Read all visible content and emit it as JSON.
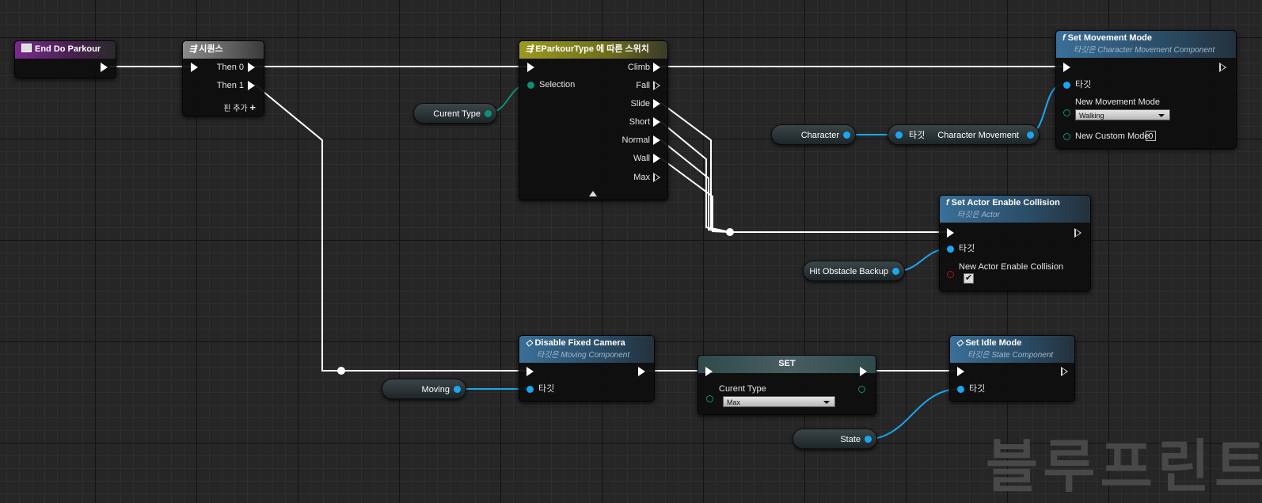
{
  "nodes": {
    "end_do_parkour": {
      "title": "End Do Parkour",
      "icon": "event-icon"
    },
    "sequence": {
      "title": "시퀀스",
      "then0": "Then 0",
      "then1": "Then 1",
      "add_pin": "핀 추가"
    },
    "switch": {
      "title": "EParkourType 에 따른 스위치",
      "selection": "Selection",
      "outputs": [
        "Climb",
        "Fall",
        "Slide",
        "Short",
        "Normal",
        "Wall",
        "Max"
      ]
    },
    "set_movement_mode": {
      "title": "Set Movement Mode",
      "subtitle": "타깃은 Character Movement Component",
      "target": "타깃",
      "mode_label": "New Movement Mode",
      "mode_value": "Walking",
      "custom_label": "New Custom Mode",
      "custom_value": "0"
    },
    "get_char_movement": {
      "target": "타깃",
      "output": "Character Movement"
    },
    "set_actor_collision": {
      "title": "Set Actor Enable Collision",
      "subtitle": "타깃은 Actor",
      "target": "타깃",
      "param": "New Actor Enable Collision",
      "checked": "✔"
    },
    "disable_fixed_camera": {
      "title": "Disable Fixed Camera",
      "subtitle": "타깃은 Moving Component",
      "target": "타깃"
    },
    "set_var": {
      "title": "SET",
      "var_label": "Curent Type",
      "value": "Max"
    },
    "set_idle_mode": {
      "title": "Set Idle Mode",
      "subtitle": "타깃은 State Component",
      "target": "타깃"
    }
  },
  "variables": {
    "curent_type": "Curent Type",
    "character": "Character",
    "hit_obstacle_backup": "Hit Obstacle Backup",
    "moving": "Moving",
    "state": "State"
  },
  "watermark": "블루프린트",
  "colors": {
    "exec_wire": "#ffffff",
    "object_wire": "#1aa6f0",
    "enum_wire": "#0d8f7a",
    "bool_pin": "#b01515"
  }
}
